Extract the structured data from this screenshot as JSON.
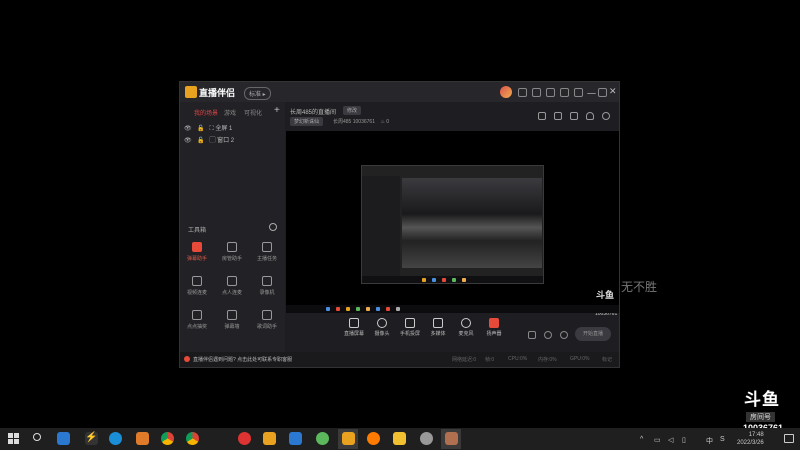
{
  "app": {
    "name": "直播伴侣",
    "version_badge": "标准 ▸",
    "titlebar_icons": [
      "skin-icon",
      "message-icon",
      "gift-icon",
      "shirt-icon",
      "menu-icon",
      "minimize-icon",
      "maximize-icon",
      "close-icon"
    ]
  },
  "left_panel": {
    "tabs": [
      "我的场景",
      "游戏",
      "可视化"
    ],
    "active_tab": "我的场景",
    "add_label": "+",
    "scenes": [
      {
        "label": "全屏 1"
      },
      {
        "label": "窗口 2"
      }
    ],
    "tools_title": "工具箱",
    "tools": [
      {
        "label": "弹幕助手",
        "icon": "danmaku-icon",
        "red": true
      },
      {
        "label": "房管助手",
        "icon": "user-icon",
        "red": false
      },
      {
        "label": "主播任务",
        "icon": "task-icon",
        "red": false
      },
      {
        "label": "视频连麦",
        "icon": "camera-link-icon",
        "red": false
      },
      {
        "label": "点人连麦",
        "icon": "download-icon",
        "red": false
      },
      {
        "label": "录像机",
        "icon": "download-icon",
        "red": false
      },
      {
        "label": "点点抽奖",
        "icon": "download-icon",
        "red": false
      },
      {
        "label": "弹幕墙",
        "icon": "barrage-wall-icon",
        "red": false
      },
      {
        "label": "歌词助手",
        "icon": "lyrics-icon",
        "red": false
      }
    ]
  },
  "header": {
    "room_title": "长周485的直播间",
    "edit_label": "修改",
    "category": "梦幻新诛仙",
    "room_meta": "长周485   10036761",
    "fans": "0"
  },
  "preview": {
    "mini_brand": "斗鱼",
    "mini_room": "10036761"
  },
  "controls": [
    {
      "label": "直播屏幕",
      "icon": "screen-icon",
      "red": false
    },
    {
      "label": "摄像头",
      "icon": "webcam-icon",
      "red": false
    },
    {
      "label": "手机投屏",
      "icon": "phone-icon",
      "red": false
    },
    {
      "label": "多媒体",
      "icon": "media-icon",
      "red": false
    },
    {
      "label": "麦克风",
      "icon": "microphone-icon",
      "red": false
    },
    {
      "label": "扬声器",
      "icon": "speaker-icon",
      "red": true
    }
  ],
  "start_button": "开始直播",
  "status": {
    "message": "直播伴侣遇到问题? 点击此处可联系专职客服",
    "stats": [
      "网络延迟:0",
      "帧:0",
      "CPU:0%",
      "内存:0%",
      "GPU:0%",
      "标记"
    ]
  },
  "side_text": "无不胜",
  "watermark": {
    "brand": "斗鱼",
    "label": "房间号",
    "room": "10036761"
  },
  "taskbar": {
    "tray_lang": "中",
    "tray_ime": "S",
    "time": "17:48",
    "date": "2022/3/26",
    "apps": [
      "mail",
      "sword",
      "edge",
      "game",
      "chrome",
      "chrome2",
      "weibo",
      "video",
      "edit",
      "qq",
      "todo",
      "douyu",
      "firefox",
      "notes",
      "photo",
      "douyu-live"
    ]
  },
  "colors": {
    "accent": "#e84a3a",
    "window_bg": "#1e1e22",
    "taskbar_bg": "#1f1f1f"
  }
}
